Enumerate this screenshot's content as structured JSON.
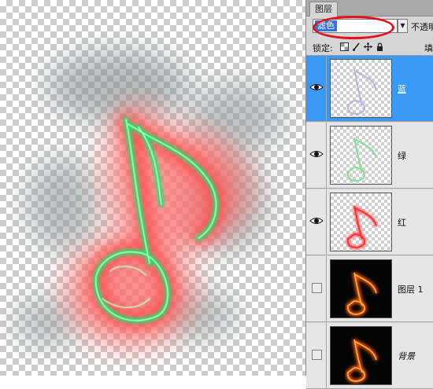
{
  "panel": {
    "tab_label": "图层",
    "blend_mode": "滤色",
    "opacity_label": "不透明",
    "lock_label": "锁定:",
    "fill_label": "填",
    "lock_icons": [
      "lock-transparent-icon",
      "lock-paint-icon",
      "lock-move-icon",
      "lock-all-icon"
    ]
  },
  "layers": [
    {
      "name": "蓝",
      "visible": true,
      "selected": true,
      "thumb": "blue-note-thumbnail"
    },
    {
      "name": "绿",
      "visible": true,
      "selected": false,
      "thumb": "green-note-thumbnail"
    },
    {
      "name": "红",
      "visible": true,
      "selected": false,
      "thumb": "red-note-thumbnail"
    },
    {
      "name": "图层 1",
      "visible": false,
      "selected": false,
      "thumb": "fire-note-thumbnail"
    },
    {
      "name": "背景",
      "visible": false,
      "selected": false,
      "thumb": "fire-note-background-thumbnail"
    }
  ],
  "colors": {
    "selection": "#3a99f5",
    "highlight_ring": "#e2131b",
    "glow_red": "#ff3a3a",
    "glow_green": "#1fd460"
  }
}
